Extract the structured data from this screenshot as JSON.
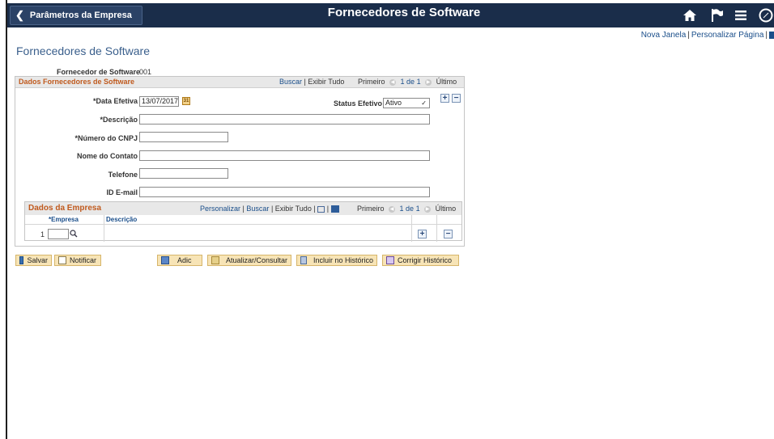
{
  "header": {
    "back_label": "Parâmetros da Empresa",
    "title": "Fornecedores de Software",
    "icons": [
      "home-icon",
      "flag-icon",
      "menu-icon",
      "navbar-icon"
    ]
  },
  "toplinks": {
    "new_window": "Nova Janela",
    "personalize_page": "Personalizar Página"
  },
  "page_title": "Fornecedores de Software",
  "supplier": {
    "label": "Fornecedor de Software",
    "value": "001"
  },
  "section": {
    "title": "Dados Fornecedores de Software",
    "find": "Buscar",
    "view_all": "Exibir Tudo",
    "first": "Primeiro",
    "count": "1 de 1",
    "last": "Último"
  },
  "fields": {
    "effdt_label": "*Data Efetiva",
    "effdt_value": "13/07/2017",
    "status_label": "Status Efetivo",
    "status_value": "Ativo",
    "descr_label": "*Descrição",
    "cnpj_label": "*Número do CNPJ",
    "contact_label": "Nome do Contato",
    "phone_label": "Telefone",
    "email_label": "ID E-mail"
  },
  "company_grid": {
    "title": "Dados da Empresa",
    "personalize": "Personalizar",
    "find": "Buscar",
    "view_all": "Exibir Tudo",
    "first": "Primeiro",
    "count": "1 de 1",
    "last": "Último",
    "col_company": "*Empresa",
    "col_descr": "Descrição",
    "rows": [
      {
        "num": "1",
        "company": "",
        "descr": ""
      }
    ]
  },
  "buttons": {
    "save": "Salvar",
    "notify": "Notificar",
    "add": "Adic",
    "update": "Atualizar/Consultar",
    "history": "Incluir no Histórico",
    "correct": "Corrigir Histórico"
  },
  "colors": {
    "header_bg": "#1a2d4a",
    "section_title": "#c05a1e",
    "link": "#1a4e8a",
    "button_bg": "#f7e4b6"
  }
}
